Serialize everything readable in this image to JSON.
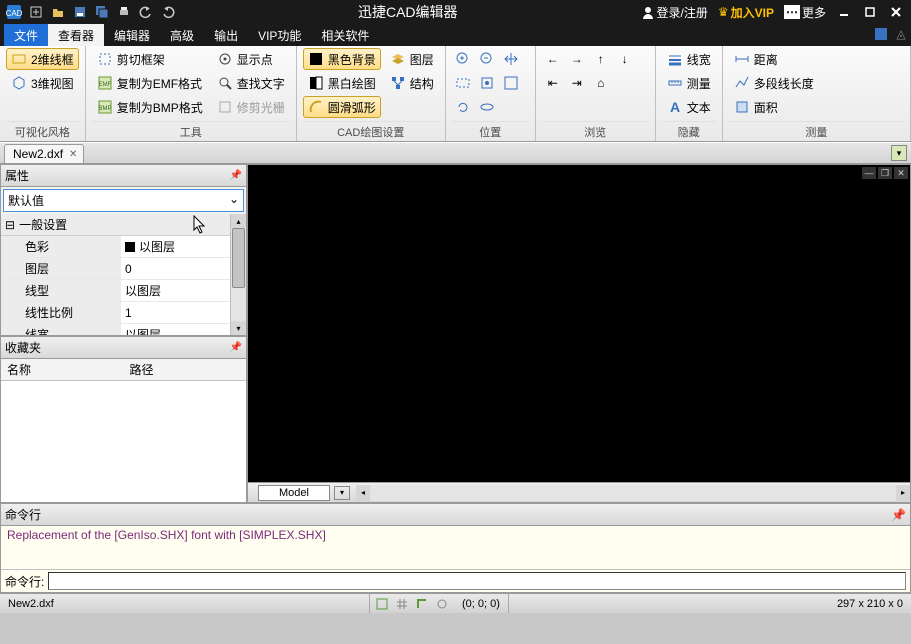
{
  "app": {
    "title": "迅捷CAD编辑器"
  },
  "titlebar_right": {
    "login": "登录/注册",
    "vip": "加入VIP",
    "more": "更多"
  },
  "menu": {
    "file": "文件",
    "tabs": [
      "查看器",
      "编辑器",
      "高级",
      "输出",
      "VIP功能",
      "相关软件"
    ],
    "active": 0
  },
  "ribbon": {
    "groups": [
      {
        "label": "可视化风格",
        "items": [
          {
            "t": "2维线框",
            "sel": true
          },
          {
            "t": "3维视图"
          }
        ]
      },
      {
        "label": "工具",
        "items": [
          {
            "t": "剪切框架"
          },
          {
            "t": "复制为EMF格式"
          },
          {
            "t": "复制为BMP格式"
          },
          {
            "t": "显示点"
          },
          {
            "t": "查找文字"
          },
          {
            "t": "修剪光栅",
            "disabled": true
          }
        ]
      },
      {
        "label": "CAD绘图设置",
        "items": [
          {
            "t": "黑色背景",
            "sel": true
          },
          {
            "t": "黑白绘图"
          },
          {
            "t": "圆滑弧形",
            "sel": true
          },
          {
            "t": "图层"
          },
          {
            "t": "结构"
          }
        ]
      },
      {
        "label": "位置"
      },
      {
        "label": "浏览"
      },
      {
        "label": "隐藏",
        "items": [
          {
            "t": "线宽"
          },
          {
            "t": "测量"
          },
          {
            "t": "文本"
          }
        ]
      },
      {
        "label": "测量",
        "items": [
          {
            "t": "距离"
          },
          {
            "t": "多段线长度"
          },
          {
            "t": "面积"
          }
        ]
      }
    ]
  },
  "doc": {
    "tab": "New2.dxf"
  },
  "panels": {
    "props": {
      "title": "属性",
      "selector": "默认值",
      "category": "一般设置",
      "rows": [
        {
          "k": "色彩",
          "v": "以图层",
          "swatch": true
        },
        {
          "k": "图层",
          "v": "0"
        },
        {
          "k": "线型",
          "v": "以图层"
        },
        {
          "k": "线性比例",
          "v": "1"
        },
        {
          "k": "线宽",
          "v": "以图层"
        }
      ]
    },
    "fav": {
      "title": "收藏夹",
      "cols": [
        "名称",
        "路径"
      ]
    }
  },
  "canvas": {
    "modeltab": "Model"
  },
  "cmd": {
    "title": "命令行",
    "log": "Replacement of the [GenIso.SHX] font with [SIMPLEX.SHX]",
    "prompt": "命令行:"
  },
  "status": {
    "file": "New2.dxf",
    "coords": "(0; 0; 0)",
    "dims": "297 x 210 x 0"
  }
}
